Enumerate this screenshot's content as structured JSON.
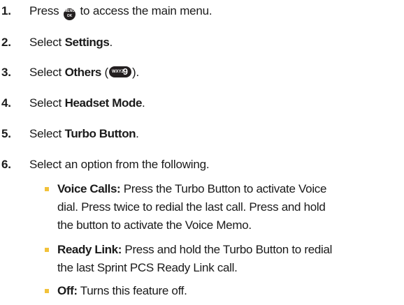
{
  "steps": [
    {
      "num": "1.",
      "pre": "Press",
      "icon": "menu-ok-key-icon",
      "post": "to access the main menu."
    },
    {
      "num": "2.",
      "pre": "Select",
      "bold": "Settings",
      "post": "."
    },
    {
      "num": "3.",
      "pre": "Select",
      "bold": "Others",
      "open": "(",
      "key": {
        "letters": "WXYZ",
        "digit": "9"
      },
      "close": ")."
    },
    {
      "num": "4.",
      "pre": "Select",
      "bold": "Headset Mode",
      "post": "."
    },
    {
      "num": "5.",
      "pre": "Select",
      "bold": "Turbo Button",
      "post": "."
    },
    {
      "num": "6.",
      "text": "Select an option from the following."
    }
  ],
  "menu_key": {
    "line1": "MENU",
    "line2": "OK"
  },
  "options": [
    {
      "label": "Voice Calls:",
      "lines": [
        "Press the Turbo Button to activate Voice",
        "dial. Press twice to redial the last call. Press and hold",
        "the button to activate the Voice Memo."
      ]
    },
    {
      "label": "Ready Link:",
      "lines": [
        "Press and hold the Turbo Button to redial",
        "the last Sprint PCS Ready Link call."
      ]
    },
    {
      "label": "Off:",
      "lines": [
        "Turns this feature off."
      ]
    }
  ],
  "colors": {
    "text": "#1a1a1a",
    "bullet": "#f2c23a",
    "key": "#231f20"
  }
}
